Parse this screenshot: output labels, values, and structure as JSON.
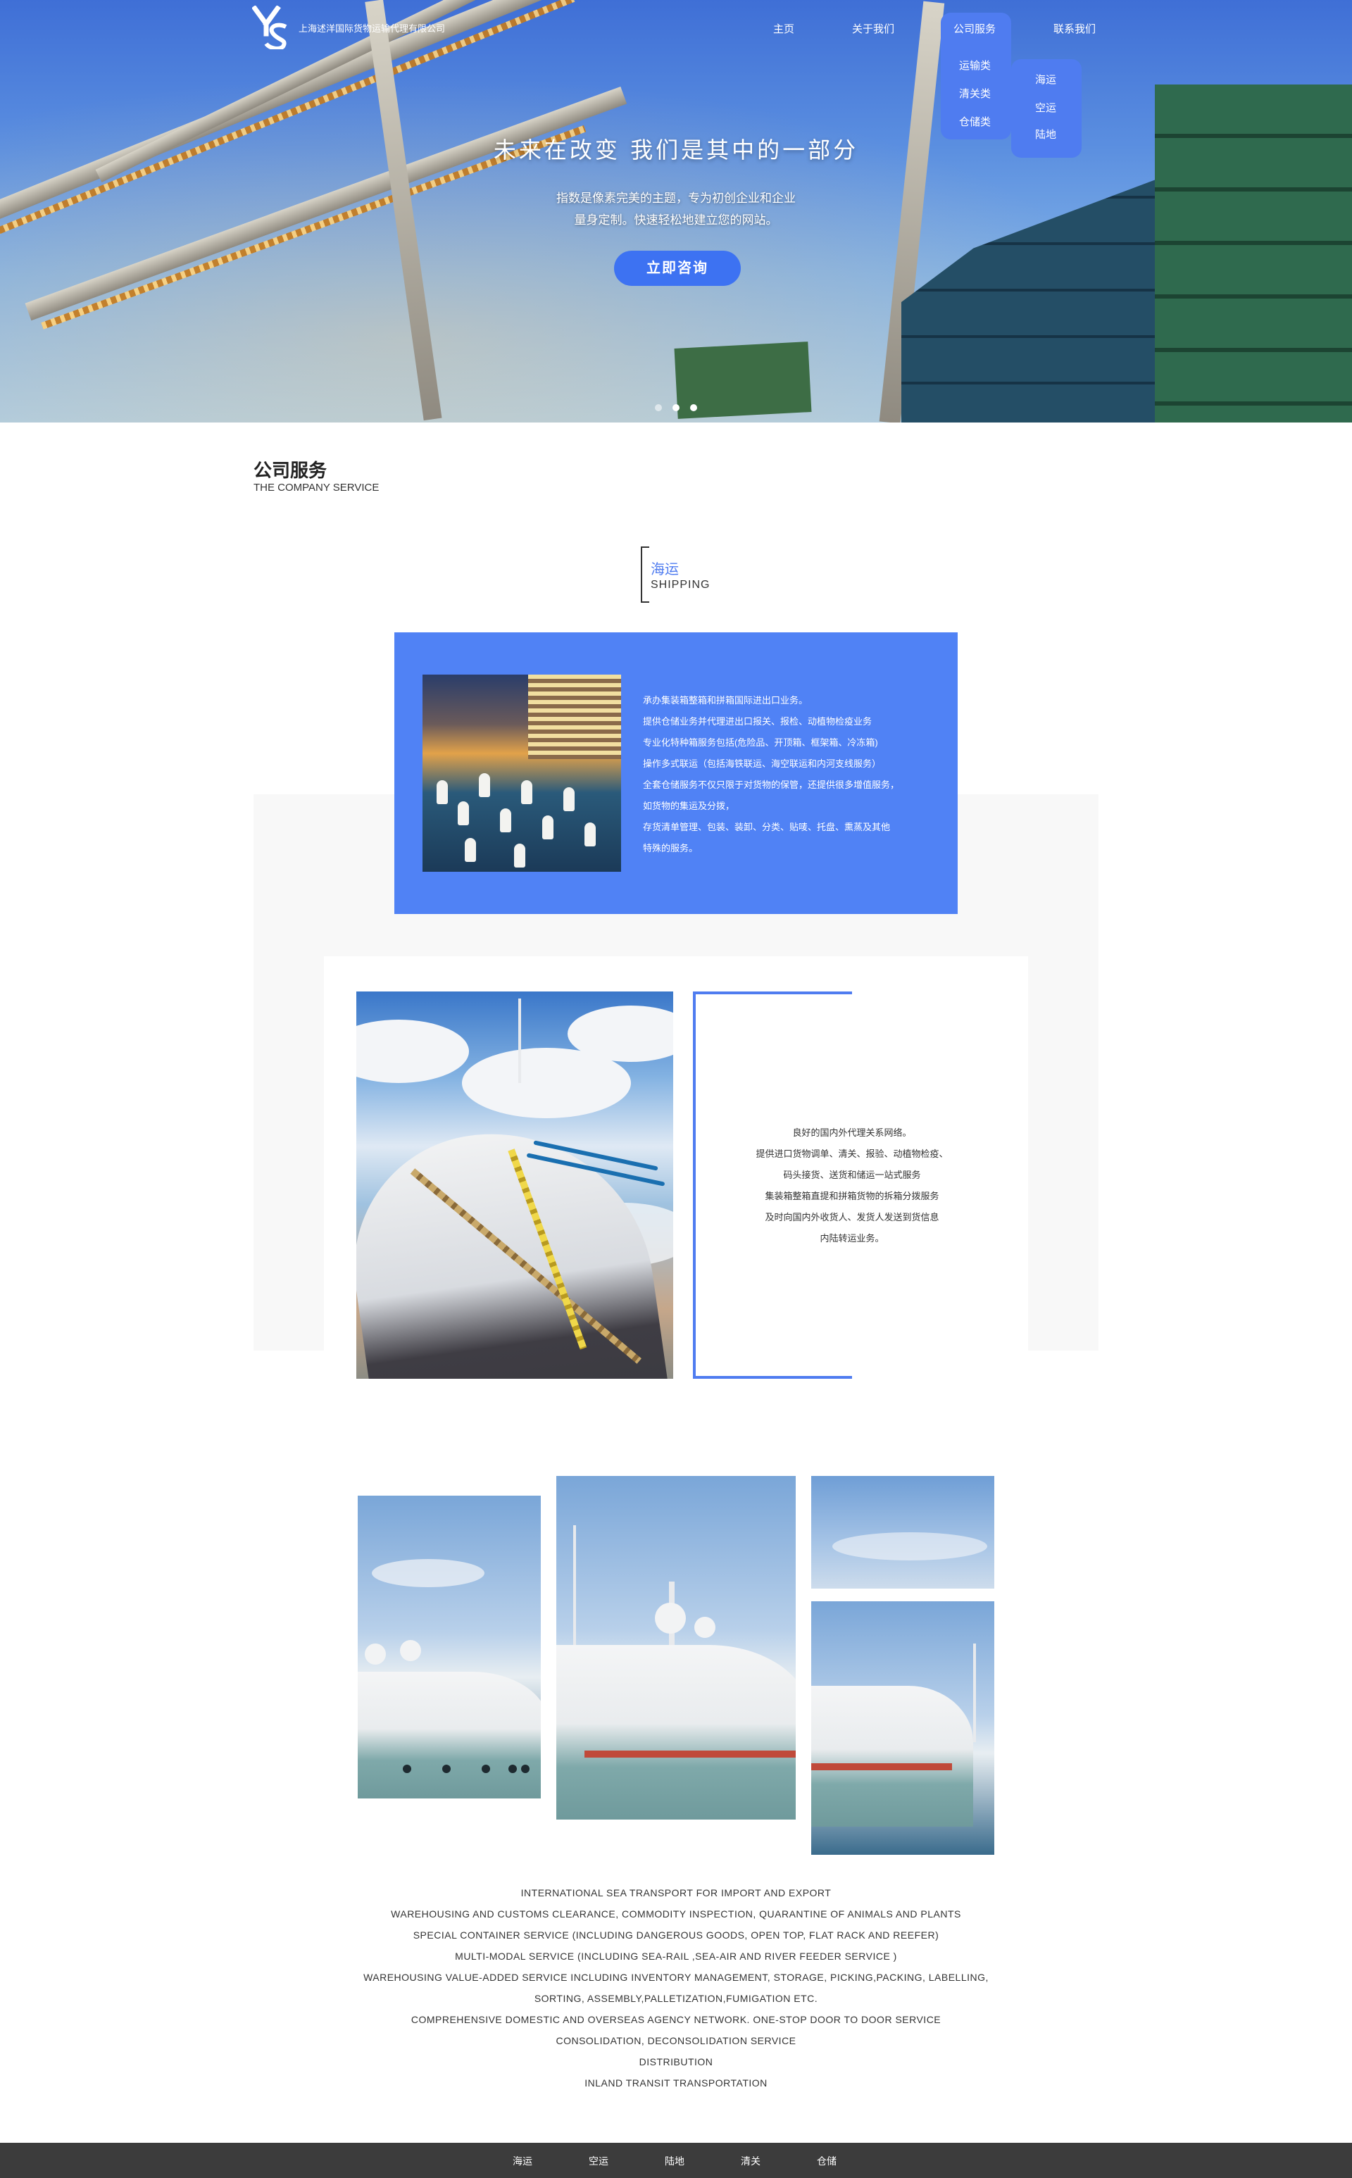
{
  "header": {
    "company_name": "上海述洋国际货物运输代理有限公司",
    "menu": [
      "主页",
      "关于我们",
      "公司服务",
      "联系我们"
    ],
    "service_dropdown": [
      "运输类",
      "清关类",
      "仓储类"
    ],
    "transport_dropdown": [
      "海运",
      "空运",
      "陆地"
    ]
  },
  "hero": {
    "title": "未来在改变 我们是其中的一部分",
    "subtitle_lines": [
      "指数是像素完美的主题，专为初创企业和企业",
      "量身定制。快速轻松地建立您的网站。"
    ],
    "cta_label": "立即咨询",
    "slide_count": 3,
    "active_slide": 1
  },
  "services": {
    "title": "公司服务",
    "subtitle": "THE COMPANY SERVICE",
    "category_cn": "海运",
    "category_en": "SHIPPING"
  },
  "card1_lines": [
    "承办集装箱整箱和拼箱国际进出口业务。",
    "提供仓储业务并代理进出口报关、报检、动植物检疫业务",
    "专业化特种箱服务包括(危险品、开顶箱、框架箱、冷冻箱)",
    "操作多式联运（包括海铁联运、海空联运和内河支线服务）",
    "全套仓储服务不仅只限于对货物的保管，还提供很多增值服务，",
    "如货物的集运及分拨，",
    "存货清单管理、包装、装卸、分类、贴唛、托盘、熏蒸及其他",
    "特殊的服务。"
  ],
  "card2_lines": [
    "良好的国内外代理关系网络。",
    "提供进口货物调单、清关、报验、动植物检疫、",
    "码头接货、送货和储运一站式服务",
    "集装箱整箱直提和拼箱货物的拆箱分拨服务",
    "及时向国内外收货人、发货人发送到货信息",
    "内陆转运业务。"
  ],
  "english_lines": [
    "INTERNATIONAL SEA TRANSPORT FOR IMPORT AND EXPORT",
    "WAREHOUSING AND CUSTOMS CLEARANCE, COMMODITY INSPECTION, QUARANTINE OF ANIMALS AND PLANTS",
    "SPECIAL CONTAINER SERVICE (INCLUDING DANGEROUS GOODS, OPEN TOP, FLAT RACK AND REEFER)",
    "MULTI-MODAL SERVICE (INCLUDING SEA-RAIL ,SEA-AIR AND RIVER FEEDER SERVICE )",
    "WAREHOUSING VALUE-ADDED SERVICE INCLUDING INVENTORY MANAGEMENT, STORAGE, PICKING,PACKING, LABELLING,",
    "SORTING, ASSEMBLY,PALLETIZATION,FUMIGATION ETC.",
    "COMPREHENSIVE DOMESTIC AND OVERSEAS AGENCY NETWORK. ONE-STOP DOOR TO DOOR SERVICE",
    "CONSOLIDATION, DECONSOLIDATION SERVICE",
    "DISTRIBUTION",
    "INLAND TRANSIT TRANSPORTATION"
  ],
  "footer": {
    "links": [
      "海运",
      "空运",
      "陆地",
      "清关",
      "仓储"
    ]
  },
  "colors": {
    "accent": "#4f7cf0",
    "card_blue": "#5082f5",
    "footer_bg": "#3c3c3c"
  }
}
